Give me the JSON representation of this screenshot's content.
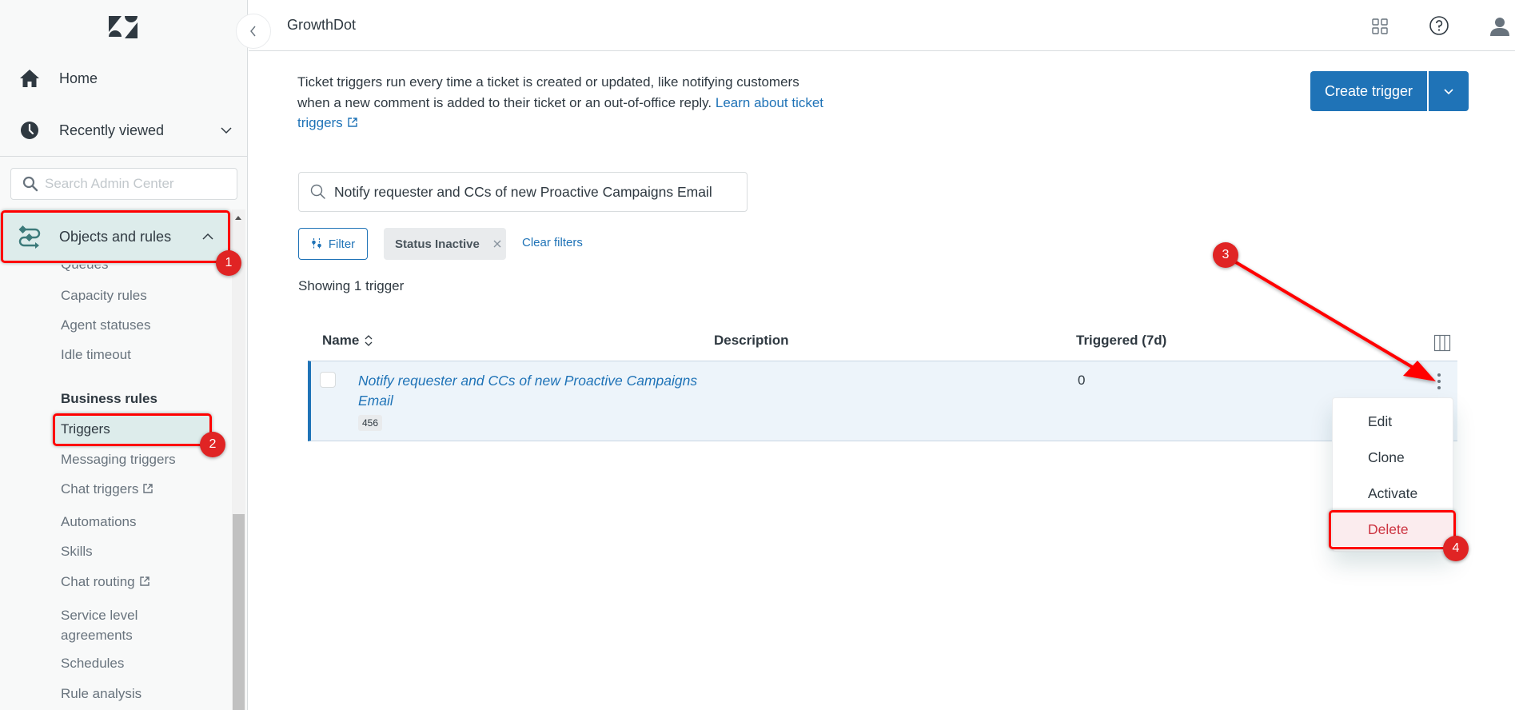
{
  "sidebar": {
    "logo": "zendesk-logo",
    "home_label": "Home",
    "recently_viewed_label": "Recently viewed",
    "search_placeholder": "Search Admin Center",
    "section_label": "Objects and rules",
    "items_above": [
      "Queues",
      "Capacity rules",
      "Agent statuses",
      "Idle timeout"
    ],
    "business_rules_heading": "Business rules",
    "items": [
      {
        "label": "Triggers",
        "external": false,
        "selected": true
      },
      {
        "label": "Messaging triggers",
        "external": false
      },
      {
        "label": "Chat triggers",
        "external": true
      },
      {
        "label": "Automations",
        "external": false
      },
      {
        "label": "Skills",
        "external": false
      },
      {
        "label": "Chat routing",
        "external": true
      },
      {
        "label": "Service level agreements",
        "external": false
      },
      {
        "label": "Schedules",
        "external": false
      },
      {
        "label": "Rule analysis",
        "external": false
      }
    ]
  },
  "header": {
    "title": "GrowthDot",
    "icons": [
      "apps-grid-icon",
      "help-icon",
      "user-avatar-icon"
    ]
  },
  "main": {
    "description": "Ticket triggers run every time a ticket is created or updated, like notifying customers when a new comment is added to their ticket or an out-of-office reply.",
    "learn_link": "Learn about ticket triggers",
    "create_button": "Create trigger",
    "search_value": "Notify requester and CCs of new Proactive Campaigns Email",
    "filter_button": "Filter",
    "status_chip": "Status Inactive",
    "clear_filters": "Clear filters",
    "showing": "Showing 1 trigger",
    "table": {
      "columns": [
        "Name",
        "Description",
        "Triggered (7d)"
      ],
      "rows": [
        {
          "name": "Notify requester and CCs of new Proactive Campaigns Email",
          "id": "456",
          "description": "",
          "triggered": "0"
        }
      ]
    },
    "row_menu": [
      "Edit",
      "Clone",
      "Activate",
      "Delete"
    ]
  },
  "annotations": [
    "1",
    "2",
    "3",
    "4"
  ],
  "colors": {
    "accent": "#1f73b7",
    "selected_bg": "#ddeceb",
    "danger": "#cc3340",
    "annotation": "#ff0000"
  }
}
